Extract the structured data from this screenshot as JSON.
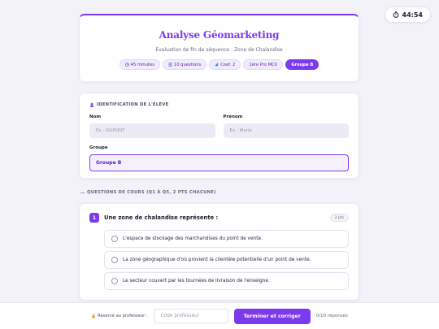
{
  "timer": {
    "label": "44:54"
  },
  "header": {
    "title": "Analyse Géomarketing",
    "subtitle": "Évaluation de fin de séquence : Zone de Chalandise",
    "badges": [
      {
        "icon": "clock-icon",
        "label": "45 minutes"
      },
      {
        "icon": "document-icon",
        "label": "10 questions"
      },
      {
        "icon": "bar-chart-icon",
        "label": "Coef. 2"
      },
      {
        "label": "1ère Pro MCV"
      },
      {
        "label": "Groupe B",
        "active": true
      }
    ]
  },
  "identification": {
    "heading": "IDENTIFICATION DE L'ÉLÈVE",
    "nom_label": "Nom",
    "nom_placeholder": "Ex : DUPONT",
    "prenom_label": "Prénom",
    "prenom_placeholder": "Ex : Marie",
    "groupe_label": "Groupe",
    "groupe_value": "Groupe B"
  },
  "section": {
    "heading": "QUESTIONS DE COURS (Q1 À Q5, 2 PTS CHACUNE)"
  },
  "question1": {
    "number": "1",
    "text": "Une zone de chalandise représente :",
    "points": "2 pts",
    "options": [
      "L'espace de stockage des marchandises du point de vente.",
      "La zone géographique d'où provient la clientèle potentielle d'un point de vente.",
      "Le secteur couvert par les tournées de livraison de l'enseigne."
    ]
  },
  "footer": {
    "reserved_label": "Réservé au professeur :",
    "code_placeholder": "Code professeur",
    "submit_label": "Terminer et corriger",
    "answers_count": "0/10 réponses"
  },
  "colors": {
    "accent": "#7c3aed",
    "background": "#f3f2f8"
  }
}
